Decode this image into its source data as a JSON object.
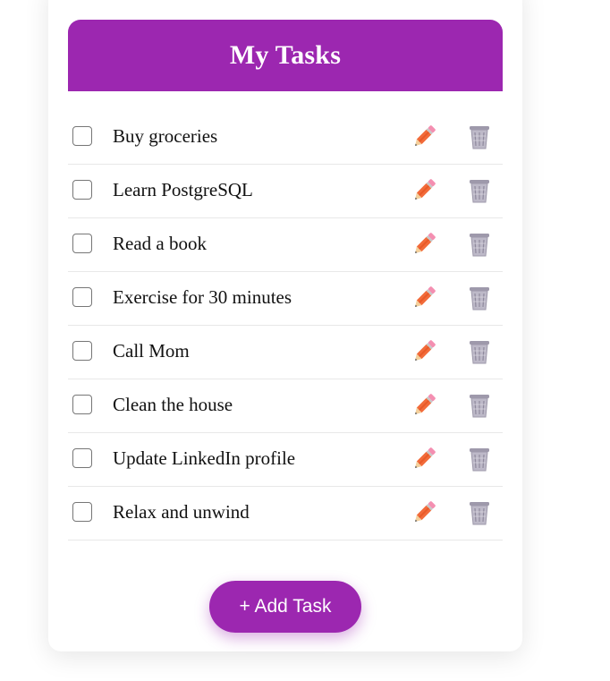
{
  "header": {
    "title": "My Tasks"
  },
  "tasks": [
    {
      "text": "Buy groceries",
      "done": false
    },
    {
      "text": "Learn PostgreSQL",
      "done": false
    },
    {
      "text": "Read a book",
      "done": false
    },
    {
      "text": "Exercise for 30 minutes",
      "done": false
    },
    {
      "text": "Call Mom",
      "done": false
    },
    {
      "text": "Clean the house",
      "done": false
    },
    {
      "text": "Update LinkedIn profile",
      "done": false
    },
    {
      "text": "Relax and unwind",
      "done": false
    }
  ],
  "icons": {
    "edit": "pencil-icon",
    "delete": "wastebasket-icon"
  },
  "actions": {
    "add_label": "+ Add Task"
  },
  "colors": {
    "accent": "#9c27b0",
    "pencil": "#f26b3a",
    "trash": "#a9a4b6"
  }
}
